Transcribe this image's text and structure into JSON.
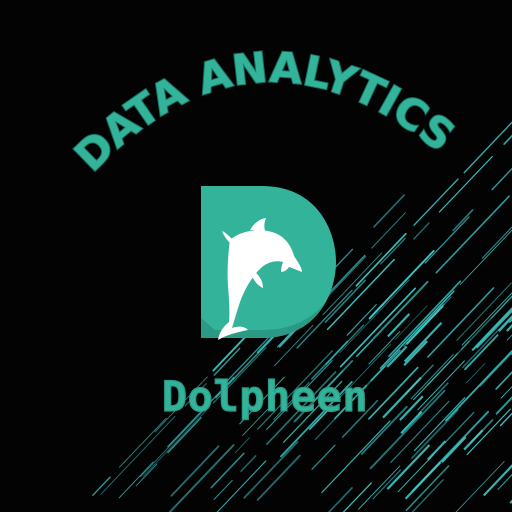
{
  "tagline": "DATA ANALYTICS",
  "brand_name": "Dolpheen",
  "colors": {
    "background": "#030303",
    "accent": "#33b39a",
    "accent_dark": "#16705f",
    "streak": "#3fd1d0",
    "dolphin": "#ffffff"
  },
  "icons": {
    "logo": "letter-d-with-dolphin",
    "background": "diagonal-light-streaks"
  }
}
